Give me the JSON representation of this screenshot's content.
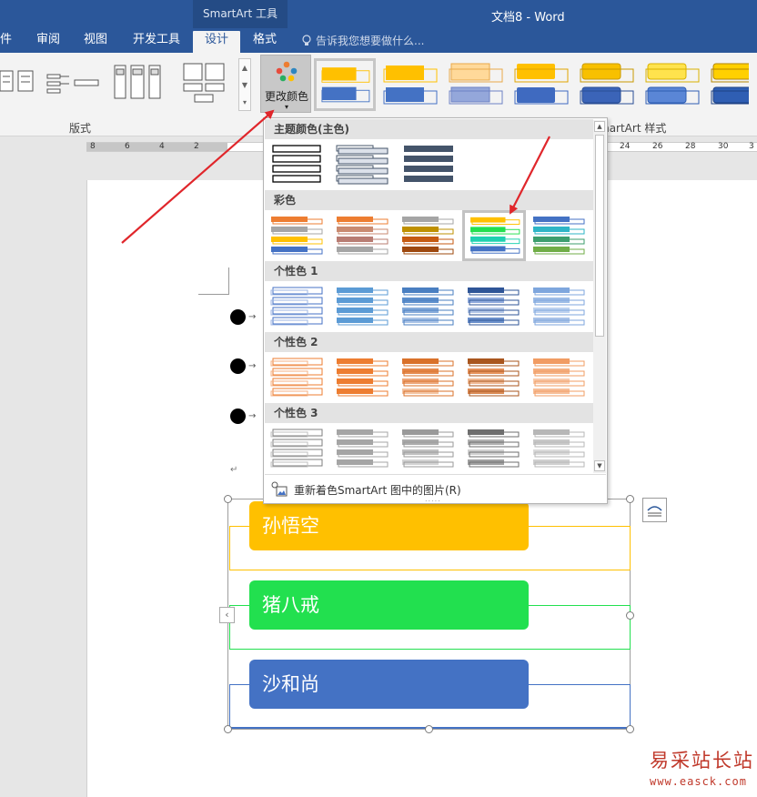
{
  "titlebar": {
    "context_group": "SmartArt 工具",
    "document_title": "文档8 - Word"
  },
  "tabs": {
    "file": "件",
    "review": "审阅",
    "view": "视图",
    "developer": "开发工具",
    "design": "设计",
    "format": "格式",
    "tell_me": "告诉我您想要做什么..."
  },
  "ribbon": {
    "layouts_label": "版式",
    "change_colors_label": "更改颜色",
    "styles_label": "SmartArt 样式",
    "styles_label_visible": "martArt 样式"
  },
  "ruler": {
    "ticks": [
      "8",
      "6",
      "4",
      "2",
      "24",
      "26",
      "28",
      "30",
      "3"
    ]
  },
  "dropdown": {
    "sections": [
      {
        "title": "主题颜色(主色)"
      },
      {
        "title": "彩色"
      },
      {
        "title": "个性色 1"
      },
      {
        "title": "个性色 2"
      },
      {
        "title": "个性色 3"
      }
    ],
    "footer_label": "重新着色SmartArt 图中的图片(R)",
    "footer_grip": "....."
  },
  "smartart": {
    "items": [
      {
        "text": "孙悟空",
        "color": "#FFC000"
      },
      {
        "text": "猪八戒",
        "color": "#22E04F"
      },
      {
        "text": "沙和尚",
        "color": "#4472C4"
      }
    ]
  },
  "colors": {
    "word_blue": "#2B579A",
    "arrow_red": "#E0262B",
    "orange": "#ED7D31",
    "gold": "#FFC000",
    "blue": "#4472C4",
    "green": "#22E04F",
    "gray": "#A5A5A5"
  },
  "watermark": {
    "name": "易采站长站",
    "url": "www.easck.com"
  }
}
